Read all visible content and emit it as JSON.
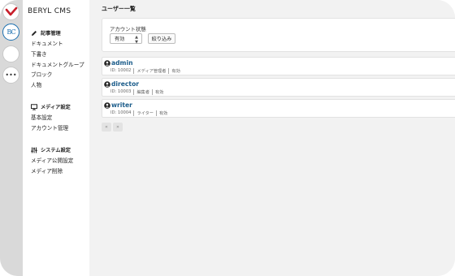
{
  "app": {
    "brand": "BERYL CMS"
  },
  "rail": {
    "logo_icon": "check-logo-icon",
    "selected_mark": "BC",
    "more_label": "•••"
  },
  "sidebar": {
    "groups": [
      {
        "title": "記事管理",
        "icon": "pencil-icon",
        "items": [
          "ドキュメント",
          "下書き",
          "ドキュメントグループ",
          "ブロック",
          "人物"
        ]
      },
      {
        "title": "メディア設定",
        "icon": "monitor-icon",
        "items": [
          "基本設定",
          "アカウント管理"
        ]
      },
      {
        "title": "システム設定",
        "icon": "sliders-icon",
        "items": [
          "メディア公開設定",
          "メディア削除"
        ]
      }
    ]
  },
  "main": {
    "title": "ユーザー一覧",
    "filter": {
      "label": "アカウント状態",
      "selected": "有効",
      "button": "絞り込み"
    },
    "users": [
      {
        "name": "admin",
        "id": "ID: 10002",
        "role": "メディア管理者",
        "status": "有効"
      },
      {
        "name": "director",
        "id": "ID: 10003",
        "role": "編集者",
        "status": "有効"
      },
      {
        "name": "writer",
        "id": "ID: 10004",
        "role": "ライター",
        "status": "有効"
      }
    ],
    "pager": {
      "prev": "«",
      "next": "»"
    }
  },
  "colors": {
    "accent": "#1a6fb0",
    "link": "#1b5c8a",
    "logo_red": "#c81e2a"
  }
}
